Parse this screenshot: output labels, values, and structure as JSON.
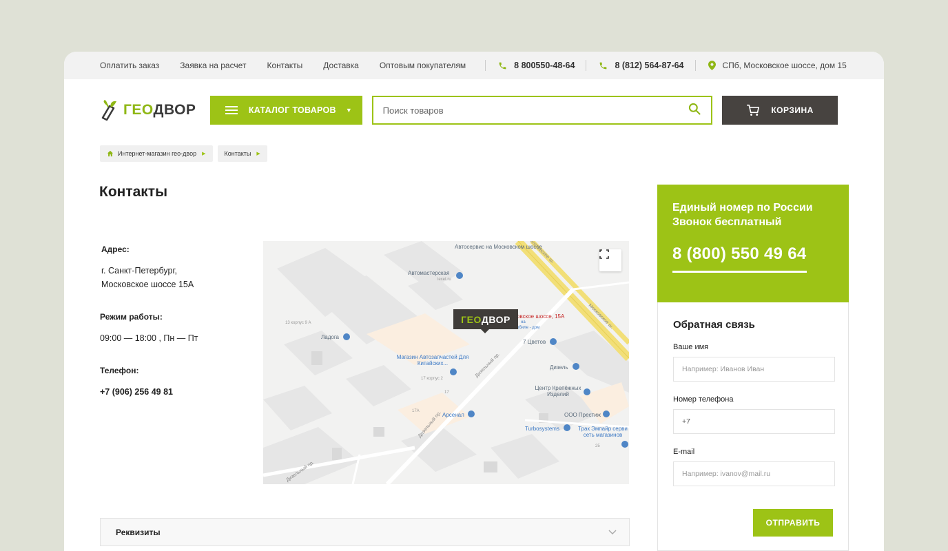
{
  "topbar": {
    "links": [
      "Оплатить заказ",
      "Заявка на расчет",
      "Контакты",
      "Доставка",
      "Оптовым покупателям"
    ],
    "phone1": "8 800550-48-64",
    "phone2": "8 (812) 564-87-64",
    "address": "СПб, Московское шоссе, дом 15"
  },
  "header": {
    "logo_geo": "ГЕО",
    "logo_dvor": "ДВОР",
    "catalog_label": "КАТАЛОГ ТОВАРОВ",
    "search_placeholder": "Поиск товаров",
    "cart_label": "КОРЗИНА"
  },
  "breadcrumb": [
    "Интернет-магазин гео-двор",
    "Контакты"
  ],
  "page_title": "Контакты",
  "info": {
    "address_label": "Адрес:",
    "address_line1": "г. Санкт-Петербург,",
    "address_line2": "Московское шоссе 15А",
    "hours_label": "Режим работы:",
    "hours_value": "09:00 — 18:00 , Пн — Пт",
    "phone_label": "Телефон:",
    "phone_value": "+7 (906) 256 49 81"
  },
  "map": {
    "marker_geo": "ГЕО",
    "marker_dvor": "ДВОР",
    "labels": {
      "autoservice": "Автосервис на Московском шоссе",
      "automaster": "Автомастерская",
      "lexet": "lexet.ru",
      "moskovskoe": "Московское ш.",
      "moskovskoe_short": "Московское ш.",
      "address": "овское шоссе, 15А",
      "addr_sub1": "на",
      "addr_sub2": "обиле - дом",
      "korpus9": "13 корпус 9 А",
      "ladoga": "Ладога",
      "tsvetov": "7 Цветов",
      "autoparts": "Магазин Автозапчастей Для Китайских...",
      "korpus2": "17 корпус 2",
      "dizel": "Дизель",
      "krepezh": "Центр Крепёжных Изделий",
      "n17": "17",
      "n17a": "17А",
      "arsenal": "Арсенал",
      "prestizh": "ООО Престиж",
      "turbo": "Turbosystems",
      "truck": "Трак Эмпайр серви сеть магазинов",
      "n25": "25",
      "dizelny1": "Дизельный пр.",
      "dizelny2": "Дизельный пр.",
      "dizelny3": "Дизельный пр."
    }
  },
  "requisites_label": "Реквизиты",
  "promo": {
    "line1": "Единый номер по России",
    "line2": "Звонок бесплатный",
    "phone": "8 (800) 550 49 64"
  },
  "feedback": {
    "title": "Обратная связь",
    "name_label": "Ваше имя",
    "name_placeholder": "Например: Иванов Иван",
    "phone_label": "Номер телефона",
    "phone_value": "+7",
    "email_label": "E-mail",
    "email_placeholder": "Например: ivanov@mail.ru",
    "submit_label": "ОТПРАВИТЬ"
  },
  "colors": {
    "accent": "#9dc316",
    "dark": "#474340",
    "page_bg": "#dfe1d6"
  }
}
